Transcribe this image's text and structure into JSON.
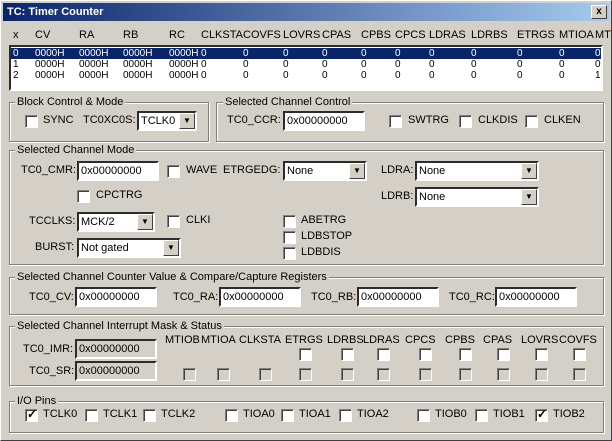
{
  "window": {
    "title": "TC: Timer Counter",
    "close_label": "x"
  },
  "list": {
    "headers": [
      "x",
      "CV",
      "RA",
      "RB",
      "RC",
      "CLKSTA",
      "COVFS",
      "LOVRS",
      "CPAS",
      "CPBS",
      "CPCS",
      "LDRAS",
      "LDRBS",
      "ETRGS",
      "MTIOA",
      "MTIOB"
    ],
    "rows": [
      [
        "0",
        "0000H",
        "0000H",
        "0000H",
        "0000H",
        "0",
        "0",
        "0",
        "0",
        "0",
        "0",
        "0",
        "0",
        "0",
        "0",
        "0"
      ],
      [
        "1",
        "0000H",
        "0000H",
        "0000H",
        "0000H",
        "0",
        "0",
        "0",
        "0",
        "0",
        "0",
        "0",
        "0",
        "0",
        "0",
        "0"
      ],
      [
        "2",
        "0000H",
        "0000H",
        "0000H",
        "0000H",
        "0",
        "0",
        "0",
        "0",
        "0",
        "0",
        "0",
        "0",
        "0",
        "0",
        "1"
      ]
    ],
    "selected_row": 0
  },
  "block_control": {
    "title": "Block Control & Mode",
    "sync_label": "SYNC",
    "sync_checked": false,
    "tc0xc0s_label": "TC0XC0S:",
    "tc0xc0s_value": "TCLK0"
  },
  "selected_channel_control": {
    "title": "Selected Channel Control",
    "ccr_label": "TC0_CCR:",
    "ccr_value": "0x00000000",
    "swtrg_label": "SWTRG",
    "clkdis_label": "CLKDIS",
    "clken_label": "CLKEN"
  },
  "selected_channel_mode": {
    "title": "Selected Channel Mode",
    "cmr_label": "TC0_CMR:",
    "cmr_value": "0x00000000",
    "wave_label": "WAVE",
    "etrgedg_label": "ETRGEDG:",
    "etrgedg_value": "None",
    "ldra_label": "LDRA:",
    "ldra_value": "None",
    "ldrb_label": "LDRB:",
    "ldrb_value": "None",
    "cpctrg_label": "CPCTRG",
    "tcclks_label": "TCCLKS:",
    "tcclks_value": "MCK/2",
    "clki_label": "CLKI",
    "abetrg_label": "ABETRG",
    "ldbstop_label": "LDBSTOP",
    "ldbdis_label": "LDBDIS",
    "burst_label": "BURST:",
    "burst_value": "Not gated"
  },
  "counter_regs": {
    "title": "Selected Channel Counter Value & Compare/Capture Registers",
    "cv_label": "TC0_CV:",
    "cv_value": "0x00000000",
    "ra_label": "TC0_RA:",
    "ra_value": "0x00000000",
    "rb_label": "TC0_RB:",
    "rb_value": "0x00000000",
    "rc_label": "TC0_RC:",
    "rc_value": "0x00000000"
  },
  "interrupt": {
    "title": "Selected Channel Interrupt Mask & Status",
    "imr_label": "TC0_IMR:",
    "imr_value": "0x00000000",
    "sr_label": "TC0_SR:",
    "sr_value": "0x00000000",
    "columns": [
      "MTIOB",
      "MTIOA",
      "CLKSTA",
      "ETRGS",
      "LDRBS",
      "LDRAS",
      "CPCS",
      "CPBS",
      "CPAS",
      "LOVRS",
      "COVFS"
    ]
  },
  "io_pins": {
    "title": "I/O Pins",
    "pins": [
      {
        "label": "TCLK0",
        "checked": true
      },
      {
        "label": "TCLK1",
        "checked": false
      },
      {
        "label": "TCLK2",
        "checked": false
      },
      {
        "label": "TIOA0",
        "checked": false
      },
      {
        "label": "TIOA1",
        "checked": false
      },
      {
        "label": "TIOA2",
        "checked": false
      },
      {
        "label": "TIOB0",
        "checked": false
      },
      {
        "label": "TIOB1",
        "checked": false
      },
      {
        "label": "TIOB2",
        "checked": true
      }
    ]
  }
}
